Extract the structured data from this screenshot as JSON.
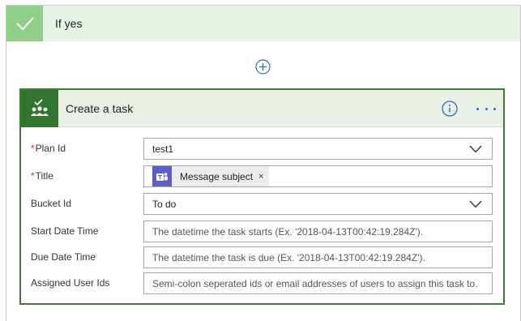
{
  "branch": {
    "title": "If yes"
  },
  "action": {
    "title": "Create a task",
    "fields": [
      {
        "label": "Plan Id",
        "required": true,
        "type": "select",
        "value": "test1"
      },
      {
        "label": "Title",
        "required": true,
        "type": "token",
        "token": {
          "text": "Message subject",
          "remove": "×"
        }
      },
      {
        "label": "Bucket Id",
        "required": false,
        "type": "select",
        "value": "To do"
      },
      {
        "label": "Start Date Time",
        "required": false,
        "type": "text",
        "placeholder": "The datetime the task starts (Ex. '2018-04-13T00:42:19.284Z')."
      },
      {
        "label": "Due Date Time",
        "required": false,
        "type": "text",
        "placeholder": "The datetime the task is due (Ex. '2018-04-13T00:42:19.284Z')."
      },
      {
        "label": "Assigned User Ids",
        "required": false,
        "type": "text",
        "placeholder": "Semi-colon seperated ids or email addresses of users to assign this task to."
      }
    ]
  },
  "colors": {
    "branch_header": "#e8f3e7",
    "branch_check": "#8fcf8a",
    "card_border": "#3e7b35",
    "card_icon": "#31752f",
    "accent_blue": "#2b6cc4",
    "teams_purple": "#5b5fc7"
  }
}
